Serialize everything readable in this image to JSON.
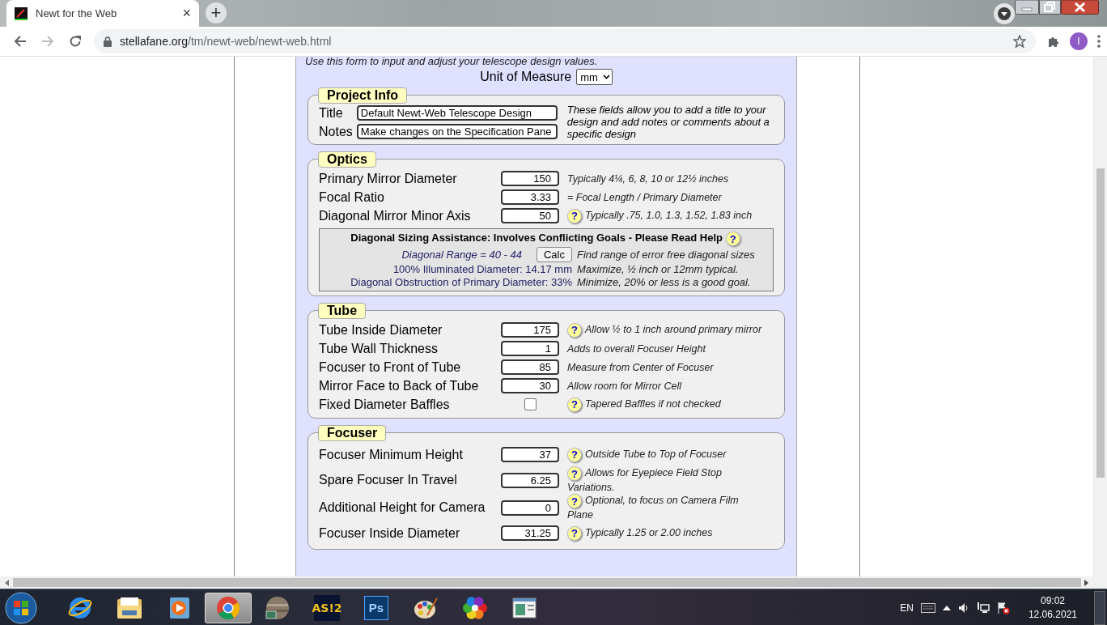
{
  "browser": {
    "tab_title": "Newt for the Web",
    "tab_close": "×",
    "new_tab": "+",
    "url_host": "stellafane.org",
    "url_path": "/tm/newt-web/newt-web.html",
    "avatar": "I"
  },
  "form": {
    "intro": "Use this form to input and adjust your telescope design values.",
    "unit_label": "Unit of Measure",
    "unit_value": "mm",
    "project": {
      "title": "Project Info",
      "fields": [
        {
          "label": "Title",
          "value": "Default Newt-Web Telescope Design"
        },
        {
          "label": "Notes",
          "value": "Make changes on the Specification Pane"
        }
      ],
      "hint": "These fields allow you to add a title to your design and add notes or comments about a specific design"
    },
    "sections": [
      {
        "title": "Optics",
        "rows": [
          {
            "kind": "input",
            "label": "Primary Mirror Diameter",
            "value": "150",
            "hint": "Typically 4¼, 6, 8, 10 or 12½ inches"
          },
          {
            "kind": "input",
            "label": "Focal Ratio",
            "value": "3.33",
            "hint": "= Focal Length / Primary Diameter"
          },
          {
            "kind": "input",
            "label": "Diagonal Mirror Minor Axis",
            "value": "50",
            "help": "?",
            "hint": "Typically .75, 1.0, 1.3, 1.52, 1.83 inch"
          }
        ],
        "assist": {
          "title": "Diagonal Sizing Assistance: Involves Conflicting Goals - Please Read Help",
          "help": "?",
          "range": "Diagonal Range = 40 - 44",
          "button": "Calc",
          "range_hint": "Find range of error free diagonal sizes",
          "results": [
            {
              "label": "100% Illuminated Diameter: 14.17 mm",
              "hint": "Maximize, ½ inch or 12mm typical."
            },
            {
              "label": "Diagonal Obstruction of Primary Diameter: 33%",
              "hint": "Minimize, 20% or less is a good goal."
            }
          ]
        }
      },
      {
        "title": "Tube",
        "rows": [
          {
            "kind": "input",
            "label": "Tube Inside Diameter",
            "value": "175",
            "help": "?",
            "hint": "Allow ½ to 1 inch around primary mirror"
          },
          {
            "kind": "input",
            "label": "Tube Wall Thickness",
            "value": "1",
            "hint": "Adds to overall Focuser Height"
          },
          {
            "kind": "input",
            "label": "Focuser to Front of Tube",
            "value": "85",
            "hint": "Measure from Center of Focuser"
          },
          {
            "kind": "input",
            "label": "Mirror Face to Back of Tube",
            "value": "30",
            "hint": "Allow room for Mirror Cell"
          },
          {
            "kind": "checkbox",
            "label": "Fixed Diameter Baffles",
            "checked": false,
            "help": "?",
            "hint": "Tapered Baffles if not checked"
          }
        ]
      },
      {
        "title": "Focuser",
        "rows": [
          {
            "kind": "input",
            "label": "Focuser Minimum Height",
            "value": "37",
            "help": "?",
            "hint": "Outside Tube to Top of Focuser"
          },
          {
            "kind": "input",
            "label": "Spare Focuser In Travel",
            "value": "6.25",
            "help": "?",
            "hint": "Allows for Eyepiece Field Stop Variations."
          },
          {
            "kind": "input",
            "label": "Additional Height for Camera",
            "value": "0",
            "help": "?",
            "hint": "Optional, to focus on Camera Film Plane"
          },
          {
            "kind": "input",
            "label": "Focuser Inside Diameter",
            "value": "31.25",
            "help": "?",
            "hint": "Typically 1.25 or 2.00 inches"
          }
        ]
      }
    ]
  },
  "taskbar": {
    "apps": [
      {
        "kind": "ie",
        "selected": false
      },
      {
        "kind": "folder",
        "selected": false
      },
      {
        "kind": "media",
        "selected": false
      },
      {
        "kind": "chrome",
        "selected": true
      },
      {
        "kind": "planet",
        "selected": false
      },
      {
        "kind": "text",
        "label": "AS!2",
        "selected": false
      },
      {
        "kind": "ps",
        "label": "Ps",
        "selected": false
      },
      {
        "kind": "palette",
        "selected": false
      },
      {
        "kind": "flower",
        "selected": false
      },
      {
        "kind": "window",
        "selected": false
      }
    ],
    "language": "EN",
    "time": "09:02",
    "date": "12.06.2021"
  }
}
